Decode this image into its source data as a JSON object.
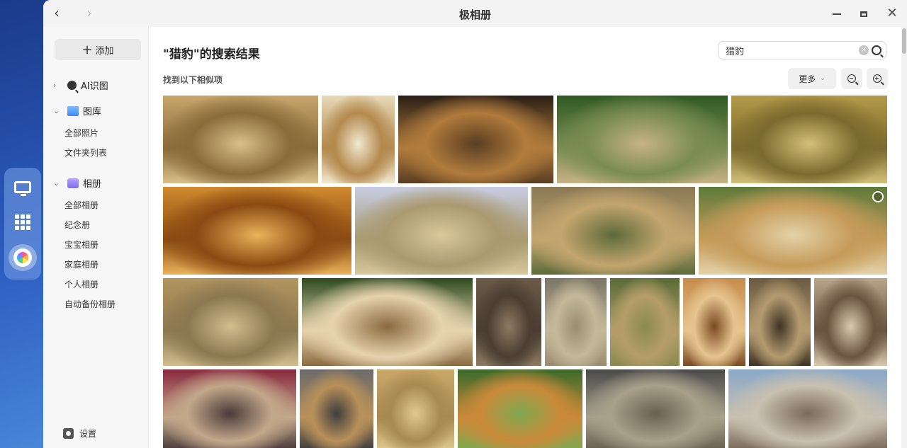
{
  "window": {
    "title": "极相册"
  },
  "sidebar": {
    "add_label": "添加",
    "sections": [
      {
        "label": "AI识图",
        "icon": "ai-search-icon",
        "expanded": false
      },
      {
        "label": "图库",
        "icon": "gallery-icon",
        "expanded": true,
        "items": [
          "全部照片",
          "文件夹列表"
        ]
      },
      {
        "label": "相册",
        "icon": "album-icon",
        "expanded": true,
        "items": [
          "全部相册",
          "纪念册",
          "宝宝相册",
          "家庭相册",
          "个人相册",
          "自动备份相册"
        ]
      }
    ],
    "settings_label": "设置"
  },
  "main": {
    "title": "\"猎豹\"的搜索结果",
    "subtitle": "找到以下相似项",
    "search": {
      "value": "猎豹"
    },
    "more_label": "更多"
  },
  "photos": [
    {
      "name": "running-cheetah",
      "colors": [
        "#c8a66b",
        "#8a6b3a",
        "#d9c08a"
      ]
    },
    {
      "name": "cheetah-portrait",
      "colors": [
        "#e7d9b8",
        "#b48a4e",
        "#f2e9d0"
      ]
    },
    {
      "name": "cheetah-face-closeup",
      "colors": [
        "#2a1f16",
        "#b07b3c",
        "#5a3d22"
      ]
    },
    {
      "name": "cheetah-standing-grass",
      "colors": [
        "#2f5a23",
        "#7a8c52",
        "#c8b385"
      ]
    },
    {
      "name": "cheetah-walking-savanna",
      "colors": [
        "#b39a4a",
        "#7b6a2e",
        "#d4c07a"
      ]
    },
    {
      "name": "cheetah-golden-walk",
      "colors": [
        "#d08a2e",
        "#8a4a12",
        "#e9b25a"
      ]
    },
    {
      "name": "cheetah-mother-cub",
      "colors": [
        "#c8cde3",
        "#a99a70",
        "#d8c89a"
      ]
    },
    {
      "name": "cheetah-cub-lying",
      "colors": [
        "#8a7a55",
        "#c3a56e",
        "#5d6a3a"
      ]
    },
    {
      "name": "cheetah-face-blur",
      "colors": [
        "#5d7a3a",
        "#c69b5a",
        "#e3d2a8"
      ]
    },
    {
      "name": "cheetah-cub-walking",
      "colors": [
        "#b29560",
        "#8c7850",
        "#d2bd8e"
      ]
    },
    {
      "name": "cheetah-snarling",
      "colors": [
        "#2e4a1e",
        "#e6d3ae",
        "#8a6a3e"
      ]
    },
    {
      "name": "cheetah-cubs-dirt",
      "colors": [
        "#6b5a48",
        "#4a3e32",
        "#8d7a62"
      ]
    },
    {
      "name": "cheetah-cub-fluffy",
      "colors": [
        "#7b7565",
        "#c3b89a",
        "#9a8c70"
      ]
    },
    {
      "name": "cheetah-cub-grass",
      "colors": [
        "#596b35",
        "#b59d6a",
        "#8a8a50"
      ]
    },
    {
      "name": "cheetah-cub-calling",
      "colors": [
        "#c68a4a",
        "#e6c48e",
        "#7a4a22"
      ]
    },
    {
      "name": "cheetah-cub-sitting",
      "colors": [
        "#6a5a40",
        "#b39a70",
        "#3e3424"
      ]
    },
    {
      "name": "cheetah-cubs-branch",
      "colors": [
        "#b8a58a",
        "#6a5540",
        "#d9c8ae"
      ]
    },
    {
      "name": "cheetah-cubs-held",
      "colors": [
        "#8a2a40",
        "#c2a88a",
        "#4a3a3a"
      ]
    },
    {
      "name": "tiger-plush-room",
      "colors": [
        "#6a6a6a",
        "#b8905a",
        "#3e3e3e"
      ]
    },
    {
      "name": "cheetah-cub-field",
      "colors": [
        "#c9a86a",
        "#a88a50",
        "#e0c98e"
      ]
    },
    {
      "name": "spotted-deer-forest",
      "colors": [
        "#3a6a2a",
        "#c98a3a",
        "#7fa850"
      ]
    },
    {
      "name": "gecko-on-branch",
      "colors": [
        "#4a4a4a",
        "#a8a08a",
        "#6a6050"
      ]
    },
    {
      "name": "snow-leopard",
      "colors": [
        "#8aa8c8",
        "#c8c0b0",
        "#7a6a5a"
      ]
    }
  ]
}
